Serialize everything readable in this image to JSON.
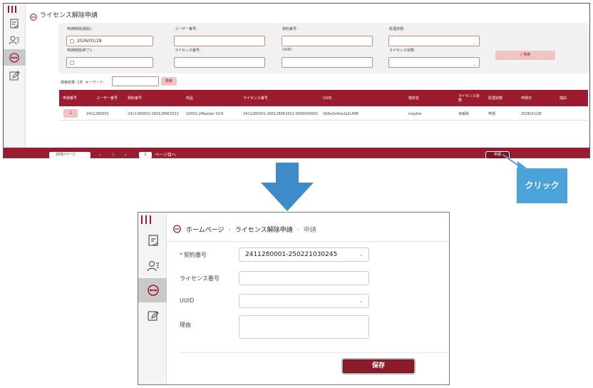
{
  "top": {
    "title": "ライセンス解除申請",
    "filters": {
      "apply_from": {
        "label": "申請時間(開始):",
        "value": "2026/01/28"
      },
      "user_no": {
        "label": "ユーザー番号:",
        "value": ""
      },
      "contract_no": {
        "label": "契約番号:",
        "value": ""
      },
      "process_status": {
        "label": "処理状態:",
        "value": ""
      },
      "apply_to": {
        "label": "申請時間(終了):",
        "value": ""
      },
      "license_no": {
        "label": "ライセンス番号:",
        "value": ""
      },
      "uuid": {
        "label": "UUID:",
        "value": ""
      },
      "license_status": {
        "label": "ライセンス状態:",
        "value": ""
      },
      "search_label": "検索"
    },
    "result_count": "検索結果: 1件",
    "keyword_label": "キーワード:",
    "keyword_search_label": "検索",
    "table": {
      "headers": [
        "申請番号",
        "ユーザー番号",
        "契約番号",
        "商品",
        "ライセンス番号",
        "UUID",
        "端末名",
        "ライセンス状態",
        "処理状態",
        "申請日",
        "理由"
      ],
      "rows": [
        [
          "1",
          "2411280001",
          "2411280001-260128063322",
          "10002-JilReader OCR",
          "2411280001-260128063322-0000000001",
          "3d3e2e4ea2a2c498",
          "maybie",
          "未解除",
          "申請",
          "2026/01/28",
          ""
        ]
      ]
    },
    "footer": {
      "per_page": "20件/ページ",
      "prev": "‹",
      "current_page": "1",
      "next": "›",
      "goto_value": "1",
      "goto_label": "ページ目へ",
      "apply_button": "申請"
    }
  },
  "callout": {
    "text": "クリック"
  },
  "bottom": {
    "breadcrumb": {
      "home": "ホームページ",
      "section": "ライセンス解除申請",
      "current": "申請"
    },
    "form": {
      "contract_no": {
        "label": "契約番号",
        "value": "2411280001-250221030245"
      },
      "license_no": {
        "label": "ライセンス番号",
        "value": ""
      },
      "uuid": {
        "label": "UUID",
        "value": ""
      },
      "reason": {
        "label": "理由",
        "value": ""
      }
    },
    "save_label": "保存"
  },
  "colors": {
    "accent": "#9b1c2e",
    "callout": "#4aa3d9",
    "arrow": "#3d8bc9"
  }
}
